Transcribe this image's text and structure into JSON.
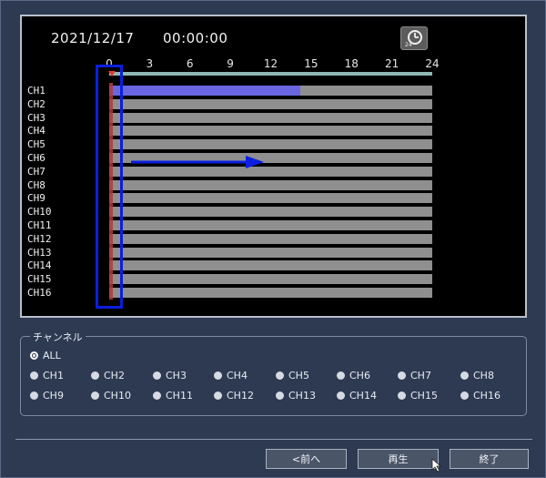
{
  "header": {
    "date": "2021/12/17",
    "time": "00:00:00"
  },
  "timeline": {
    "ticks": [
      "0",
      "3",
      "6",
      "9",
      "12",
      "15",
      "18",
      "21",
      "24"
    ],
    "channels": [
      "CH1",
      "CH2",
      "CH3",
      "CH4",
      "CH5",
      "CH6",
      "CH7",
      "CH8",
      "CH9",
      "CH10",
      "CH11",
      "CH12",
      "CH13",
      "CH14",
      "CH15",
      "CH16"
    ],
    "recording_ch1_hours": [
      0,
      14.2
    ]
  },
  "channel_group": {
    "title": "チャンネル",
    "all_label": "ALL",
    "selected": "ALL",
    "options": [
      "CH1",
      "CH2",
      "CH3",
      "CH4",
      "CH5",
      "CH6",
      "CH7",
      "CH8",
      "CH9",
      "CH10",
      "CH11",
      "CH12",
      "CH13",
      "CH14",
      "CH15",
      "CH16"
    ]
  },
  "buttons": {
    "back": "<前へ",
    "play": "再生",
    "exit": "終了"
  },
  "colors": {
    "background": "#2d3a52",
    "record_bar": "#6a66e2",
    "highlight": "#0a1fe0",
    "idle_bar": "#8f8f8f"
  }
}
